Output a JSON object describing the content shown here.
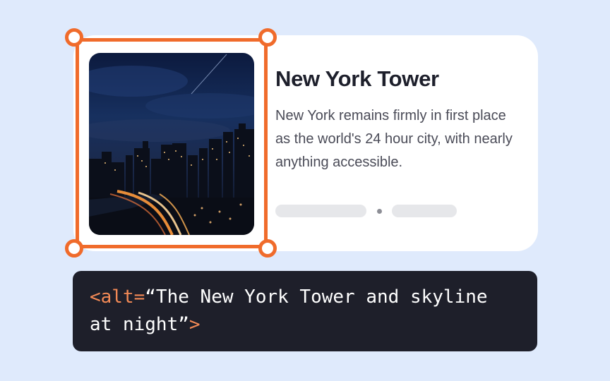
{
  "card": {
    "title": "New York Tower",
    "description": "New York remains firmly in first place as the world's 24 hour city, with nearly anything accessible."
  },
  "code": {
    "open_tag": "<alt=",
    "alt_text": "“The New York Tower and skyline at night”",
    "close_tag": ">"
  },
  "colors": {
    "background": "#dfeafc",
    "accent": "#f06b2b",
    "code_background": "#1e1f2a",
    "code_token": "#f48a56"
  }
}
